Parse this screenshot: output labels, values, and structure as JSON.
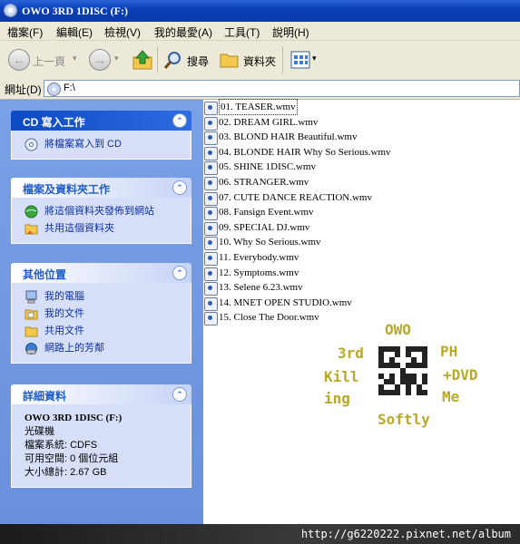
{
  "window": {
    "title": "OWO 3RD 1DISC (F:)"
  },
  "menu": [
    "檔案(F)",
    "編輯(E)",
    "檢視(V)",
    "我的最愛(A)",
    "工具(T)",
    "說明(H)"
  ],
  "toolbar": {
    "back": "上一頁",
    "search": "搜尋",
    "folders": "資料夾"
  },
  "address": {
    "label": "網址(D)",
    "value": "F:\\"
  },
  "panels": {
    "cd": {
      "title": "CD 寫入工作",
      "items": [
        "將檔案寫入到 CD"
      ]
    },
    "file_tasks": {
      "title": "檔案及資料夾工作",
      "items": [
        "將這個資料夾發佈到網站",
        "共用這個資料夾"
      ]
    },
    "other_places": {
      "title": "其他位置",
      "items": [
        "我的電腦",
        "我的文件",
        "共用文件",
        "網路上的芳鄰"
      ]
    },
    "details": {
      "title": "詳細資料",
      "name": "OWO 3RD 1DISC (F:)",
      "type": "光碟機",
      "fs": "檔案系統: CDFS",
      "free": "可用空間: 0 個位元組",
      "total": "大小總計: 2.67 GB"
    }
  },
  "files": [
    "01. TEASER.wmv",
    "02. DREAM GIRL.wmv",
    "03. BLOND HAIR Beautiful.wmv",
    "04. BLONDE HAIR Why So Serious.wmv",
    "05. SHINE 1DISC.wmv",
    "06. STRANGER.wmv",
    "07. CUTE DANCE REACTION.wmv",
    "08. Fansign Event.wmv",
    "09. SPECIAL DJ.wmv",
    "10. Why So Serious.wmv",
    "11. Everybody.wmv",
    "12. Symptoms.wmv",
    "13. Selene 6.23.wmv",
    "14. MNET OPEN STUDIO.wmv",
    "15. Close The Door.wmv"
  ],
  "watermark": {
    "top": "OWO",
    "left1": "3rd",
    "left2": "Killing",
    "right1": "PH",
    "right2": "+DVD",
    "right3": "Me",
    "bottom": "Softly"
  },
  "footer": {
    "url": "http://g6220222.pixnet.net/album"
  },
  "colors": {
    "title_bar": "#0a3fb6",
    "task_pane": "#6a90dc",
    "watermark": "#b9a928"
  }
}
